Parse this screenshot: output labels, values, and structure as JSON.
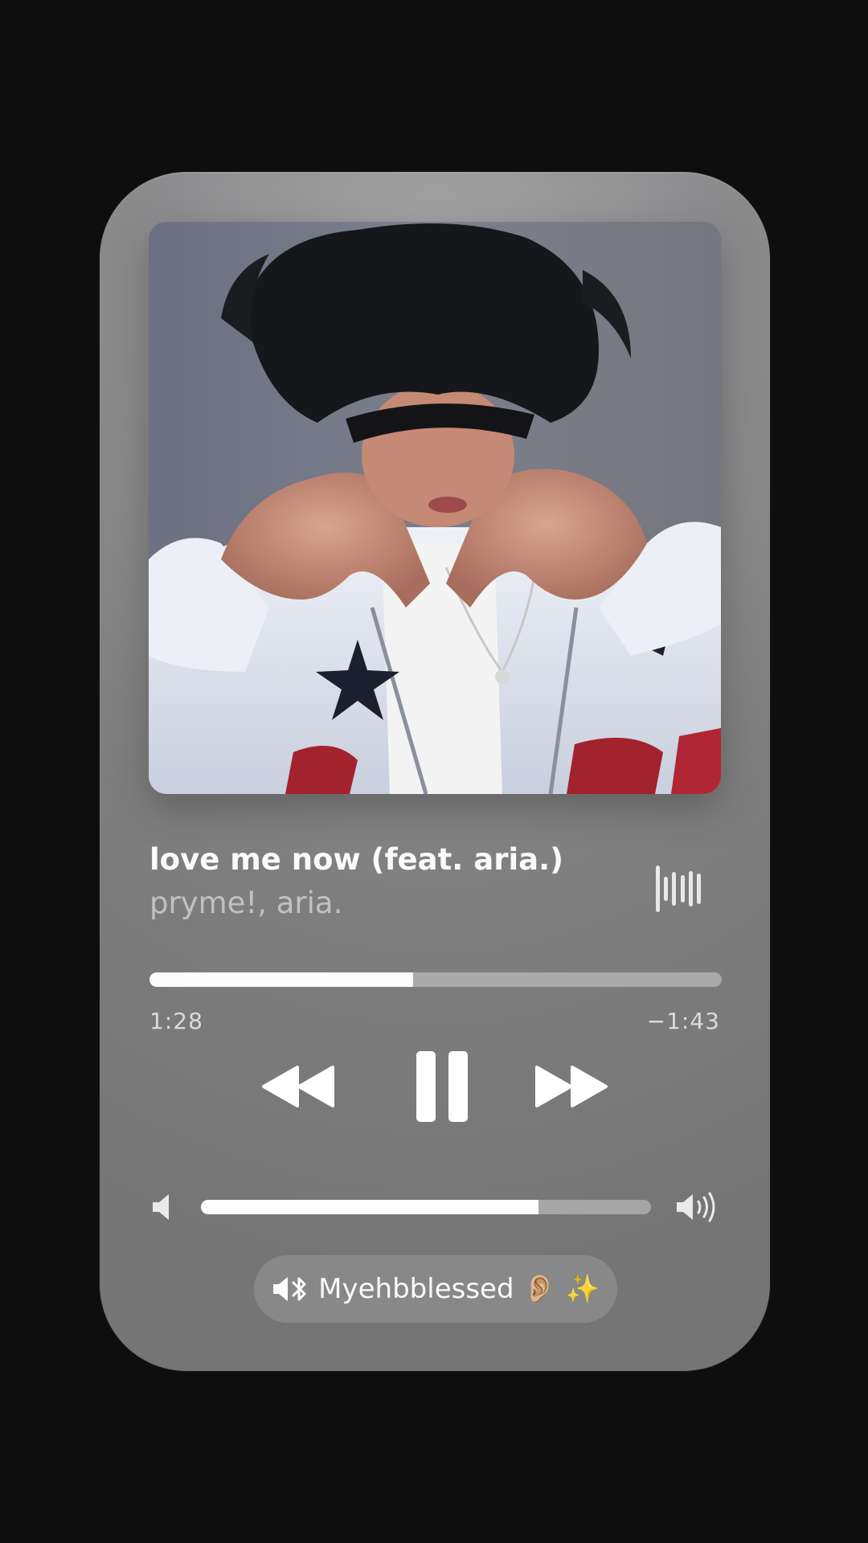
{
  "track": {
    "title": "love me now (feat. aria.)",
    "artist": "pryme!, aria."
  },
  "playback": {
    "elapsed": "1:28",
    "remaining": "−1:43",
    "progress_fraction": 0.46,
    "state": "playing"
  },
  "volume": {
    "level_fraction": 0.75
  },
  "output_device": {
    "label": "Myehbblessed 👂🏼 ✨"
  },
  "icons": {
    "visualizer": "waveform-icon",
    "rewind": "rewind-icon",
    "pause": "pause-icon",
    "forward": "fast-forward-icon",
    "volume_low": "speaker-low-icon",
    "volume_high": "speaker-high-icon",
    "device": "speaker-bluetooth-icon"
  },
  "colors": {
    "background": "#0e0e0e",
    "card": "#8d8d8f",
    "accent": "#ffffff"
  }
}
